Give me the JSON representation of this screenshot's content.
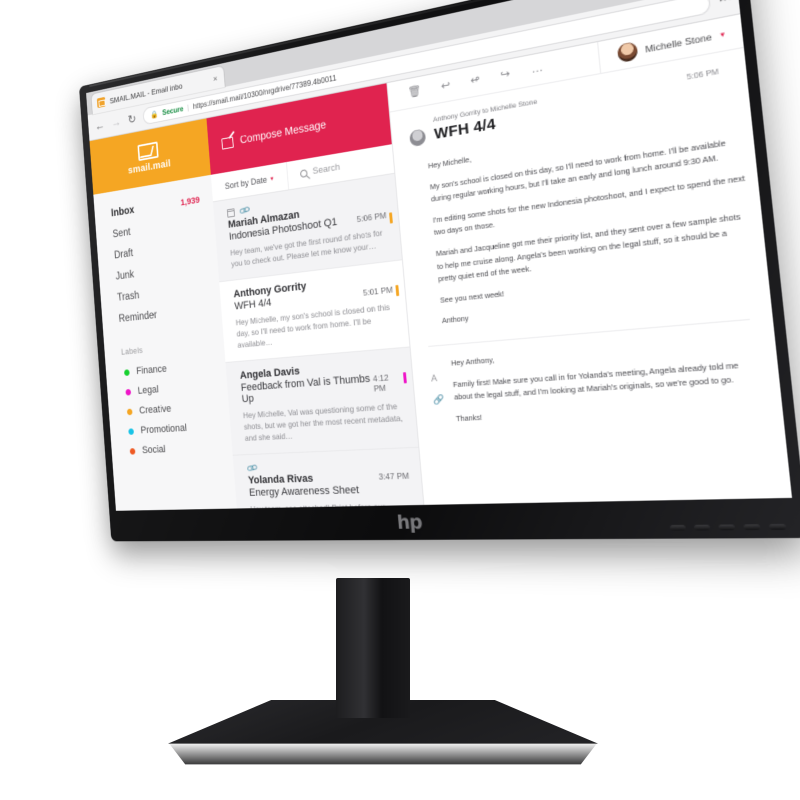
{
  "browser": {
    "tab": {
      "title": "SMAIL.MAIL - Email inbo",
      "close_label": "×",
      "favicon": "smail-favicon"
    },
    "window_controls": {
      "minimize": "–",
      "maximize": "□",
      "close": "✕"
    },
    "nav": {
      "back": "←",
      "forward": "→",
      "reload": "↻",
      "menu": "⋮"
    },
    "address_bar": {
      "lock_icon": "lock-icon",
      "secure_label": "Secure",
      "separator": "|",
      "url": "https://smail.mail/10300/nrgdrive/77389.4b0011"
    }
  },
  "app": {
    "brand": {
      "name": "smail.mail",
      "icon": "envelope-icon",
      "color": "#f5a623"
    },
    "compose": {
      "label": "Compose Message",
      "icon": "compose-icon",
      "color": "#e0234f"
    },
    "sidebar": {
      "items": [
        {
          "label": "Inbox",
          "count": "1,939",
          "active": true
        },
        {
          "label": "Sent",
          "count": "",
          "active": false
        },
        {
          "label": "Draft",
          "count": "",
          "active": false
        },
        {
          "label": "Junk",
          "count": "",
          "active": false
        },
        {
          "label": "Trash",
          "count": "",
          "active": false
        },
        {
          "label": "Reminder",
          "count": "",
          "active": false
        }
      ],
      "labels_title": "Labels",
      "labels": [
        {
          "label": "Finance",
          "color": "#17d02f"
        },
        {
          "label": "Legal",
          "color": "#ef16c8"
        },
        {
          "label": "Creative",
          "color": "#f5a623"
        },
        {
          "label": "Promotional",
          "color": "#18c3e6"
        },
        {
          "label": "Social",
          "color": "#ef5a24"
        }
      ]
    },
    "list_toolbar": {
      "sort_label": "Sort by Date",
      "sort_caret": "▾",
      "search_placeholder": "Search",
      "search_icon": "search-icon"
    },
    "messages": [
      {
        "from": "Mariah Almazan",
        "subject": "Indonesia Photoshoot Q1",
        "time": "5:06 PM",
        "preview": "Hey team, we've got the first round of shots for you to check out. Please let me know your…",
        "flag_color": "#f5a623",
        "has_calendar": true,
        "has_attachment": true,
        "state": "read"
      },
      {
        "from": "Anthony Gorrity",
        "subject": "WFH 4/4",
        "time": "5:01 PM",
        "preview": "Hey Michelle, my son's school is closed on this day, so I'll need to work from home. I'll be available…",
        "flag_color": "#f5a623",
        "has_calendar": false,
        "has_attachment": false,
        "state": "selected"
      },
      {
        "from": "Angela Davis",
        "subject": "Feedback from Val is Thumbs Up",
        "time": "4:12 PM",
        "preview": "Hey Michelle, Val was questioning some of the shots, but we got her the most recent metadata, and she said…",
        "flag_color": "#ef16c8",
        "has_calendar": false,
        "has_attachment": false,
        "state": "read"
      },
      {
        "from": "Yolanda Rivas",
        "subject": "Energy Awareness Sheet",
        "time": "3:47 PM",
        "preview": "Hey team, see attached! Print before our meeting this afternoon.",
        "flag_color": "",
        "has_calendar": false,
        "has_attachment": true,
        "state": "read"
      }
    ],
    "reader_toolbar": {
      "icons": [
        "trash-icon",
        "reply-icon",
        "reply-all-icon",
        "forward-icon",
        "more-icon"
      ],
      "trash": "🗑",
      "reply": "↩",
      "reply_all": "↫",
      "forward": "↪",
      "more": "…",
      "user_name": "Michelle Stone",
      "user_caret": "▾",
      "avatar": "user-avatar"
    },
    "reading_pane": {
      "meta": "Anthony Gorrity to Michelle Stone",
      "subject": "WFH 4/4",
      "time": "5:06 PM",
      "body": [
        "Hey Michelle,",
        "My son's school is closed on this day, so I'll need to work from home. I'll be available during regular working hours, but I'll take an early and long lunch around 9:30 AM.",
        "I'm editing some shots for the new Indonesia photoshoot, and I expect to spend the next two days on those.",
        "Mariah and Jacqueline got me their priority list, and they sent over a few sample shots to help me cruise along. Angela's been working on the legal stuff, so it should be a pretty quiet end of the week.",
        "See you next week!",
        "Anthony"
      ],
      "reply": {
        "icons": [
          "font-icon",
          "attachment-icon"
        ],
        "font_glyph": "A",
        "attachment_glyph": "🔗",
        "body": [
          "Hey Anthony,",
          "Family first! Make sure you call in for Yolanda's meeting, Angela already told me about the legal stuff, and I'm looking at Mariah's originals, so we're good to go.",
          "Thanks!"
        ]
      }
    }
  },
  "hardware": {
    "brand_logo": "hp",
    "monitor": "hp-monitor",
    "stand": "monitor-stand",
    "buttons": [
      "osd-button",
      "osd-button",
      "osd-button",
      "osd-button",
      "power-button"
    ]
  }
}
